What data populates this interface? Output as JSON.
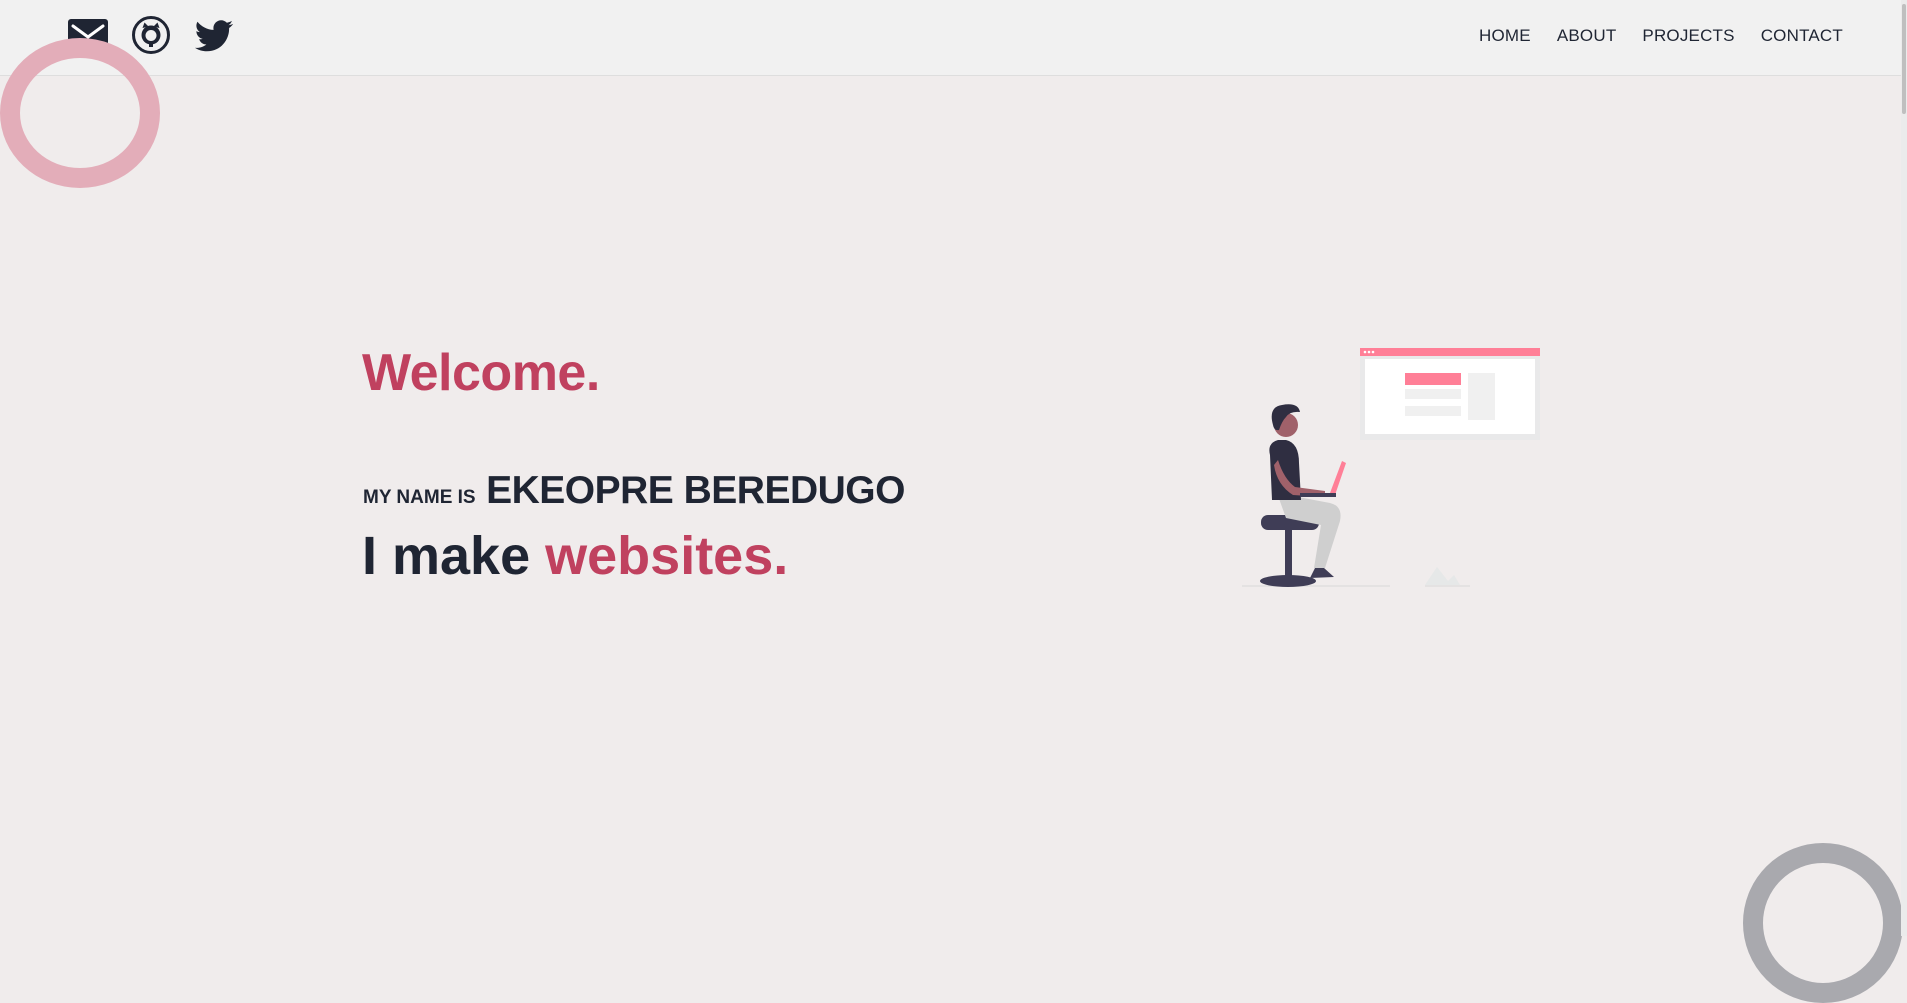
{
  "header": {
    "social": [
      {
        "name": "email-icon"
      },
      {
        "name": "github-icon"
      },
      {
        "name": "twitter-icon"
      }
    ],
    "nav": [
      "HOME",
      "ABOUT",
      "PROJECTS",
      "CONTACT"
    ]
  },
  "hero": {
    "welcome": "Welcome.",
    "name_intro": "MY NAME IS",
    "name": "EKEOPRE BEREDUGO",
    "tagline_prefix": "I make",
    "tagline_accent": "websites."
  },
  "colors": {
    "accent": "#c0415f",
    "dark": "#1f2533",
    "background": "#f0ecec",
    "ring_pink": "#e3adb9",
    "ring_gray": "#a9a9ae",
    "illustration_pink": "#ff7f97"
  }
}
